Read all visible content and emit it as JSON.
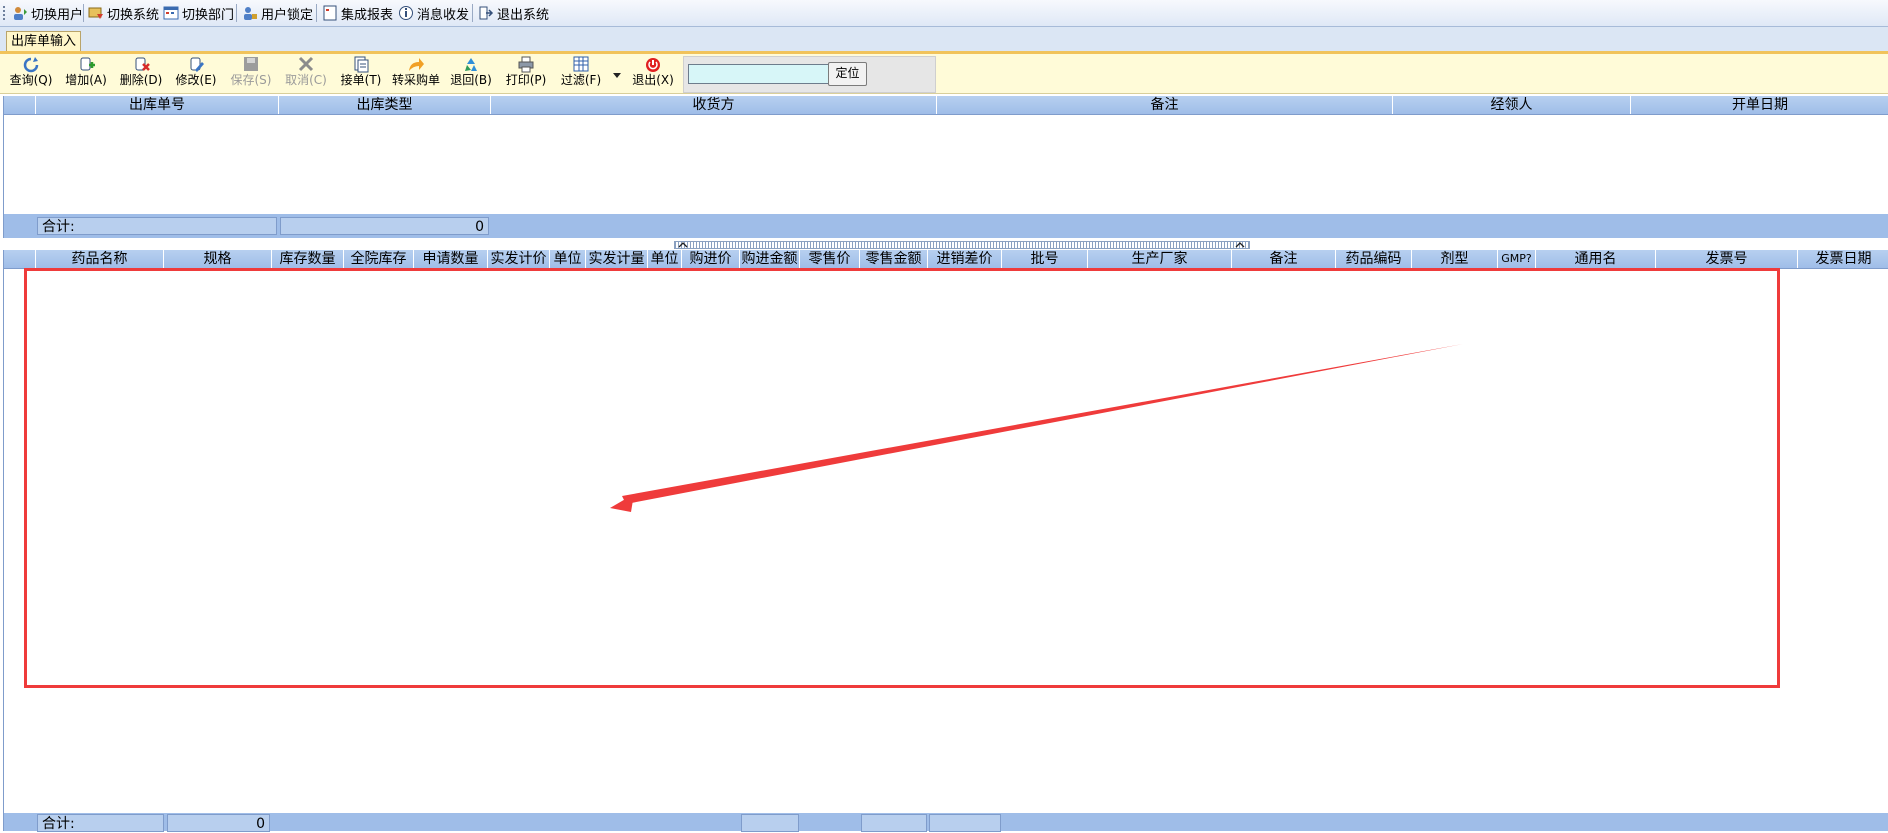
{
  "menubar": {
    "items": [
      "切换用户",
      "切换系统",
      "切换部门",
      "用户锁定",
      "集成报表",
      "消息收发",
      "退出系统"
    ],
    "icons": [
      "switch-user-icon",
      "switch-system-icon",
      "switch-department-icon",
      "user-lock-icon",
      "report-icon",
      "message-icon",
      "exit-system-icon"
    ]
  },
  "tab": {
    "label": "出库单输入"
  },
  "toolbar": {
    "query": "查询(Q)",
    "add": "增加(A)",
    "delete": "删除(D)",
    "edit": "修改(E)",
    "save": "保存(S)",
    "cancel": "取消(C)",
    "receive": "接单(T)",
    "transfer": "转采购单",
    "return": "退回(B)",
    "print": "打印(P)",
    "filter": "过滤(F)",
    "exit": "退出(X)",
    "locate": "定位",
    "search_value": ""
  },
  "upper_grid": {
    "columns": [
      "出库单号",
      "出库类型",
      "收货方",
      "备注",
      "经领人",
      "开单日期"
    ],
    "rows": [],
    "summary_label": "合计:",
    "summary_value": "0"
  },
  "lower_grid": {
    "columns": [
      "药品名称",
      "规格",
      "库存数量",
      "全院库存",
      "申请数量",
      "实发计价",
      "单位",
      "实发计量",
      "单位",
      "购进价",
      "购进金额",
      "零售价",
      "零售金额",
      "进销差价",
      "批号",
      "生产厂家",
      "备注",
      "药品编码",
      "剂型",
      "GMP?",
      "通用名",
      "发票号",
      "发票日期"
    ],
    "rows": [],
    "summary_label": "合计:",
    "summary_value": "0"
  },
  "colors": {
    "header_blue": "#9fbde8",
    "toolbar_yellow": "#fffbd8",
    "tab_accent": "#f1c35b",
    "highlight_red": "#ef3b3b"
  }
}
